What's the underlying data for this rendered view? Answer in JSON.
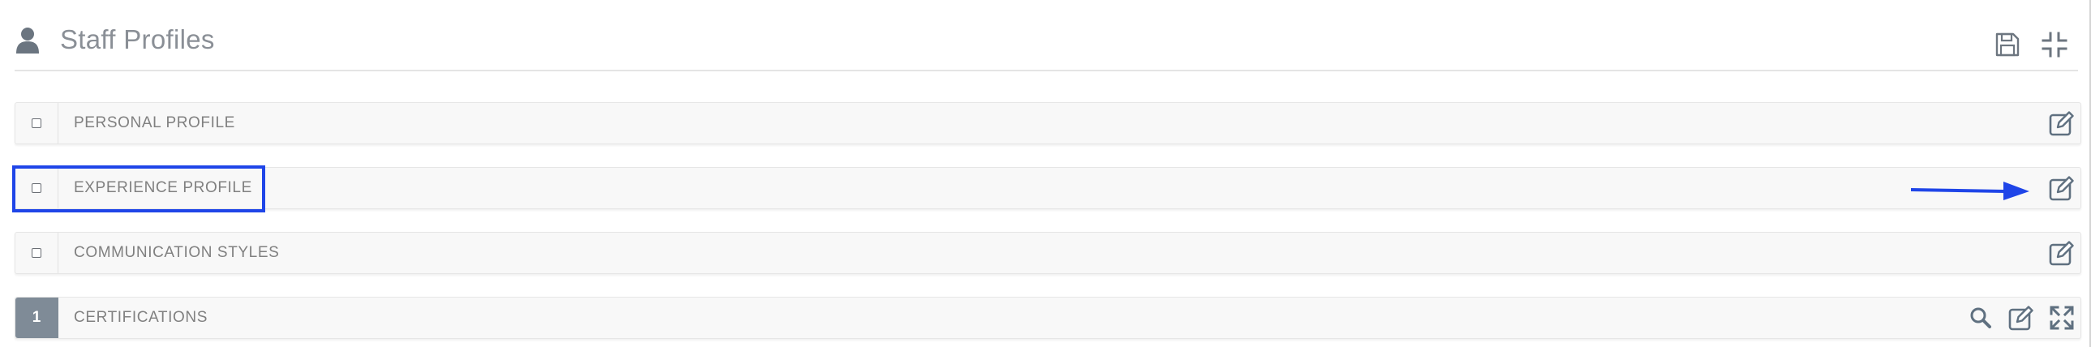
{
  "header": {
    "title": "Staff Profiles",
    "icons": [
      "user-icon",
      "save-icon",
      "compress-icon"
    ]
  },
  "sections": [
    {
      "label": "PERSONAL PROFILE",
      "toggle": "checkbox",
      "actions": [
        "edit-icon"
      ]
    },
    {
      "label": "EXPERIENCE PROFILE",
      "toggle": "checkbox",
      "actions": [
        "edit-icon"
      ],
      "highlighted": true
    },
    {
      "label": "COMMUNICATION STYLES",
      "toggle": "checkbox",
      "actions": [
        "edit-icon"
      ]
    },
    {
      "label": "CERTIFICATIONS",
      "toggle": "count",
      "count": "1",
      "actions": [
        "search-icon",
        "edit-icon",
        "expand-icon"
      ]
    }
  ],
  "colors": {
    "icon": "#5f7080",
    "title": "#8a8f96",
    "label": "#808080",
    "count_badge": "#7f8b97",
    "annotation": "#1f45e8"
  }
}
